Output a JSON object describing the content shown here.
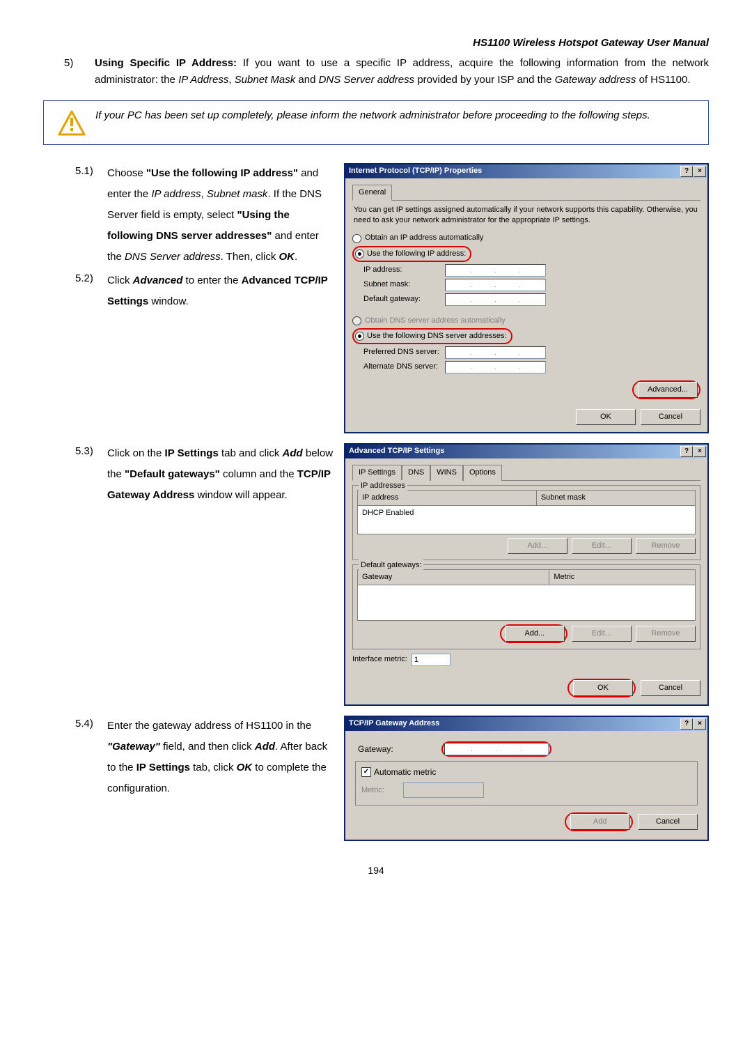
{
  "header": {
    "manual_title": "HS1100 Wireless Hotspot Gateway User Manual"
  },
  "step5": {
    "num": "5)",
    "lead_bold": "Using Specific IP Address:",
    "lead_after": " If you want to use a specific IP address, acquire the following information from the network administrator: the ",
    "i1": "IP Address",
    "c1": ", ",
    "i2": "Subnet Mask",
    "c2": " and ",
    "i3": "DNS Server address",
    "c3": " provided by your ISP and the ",
    "i4": "Gateway address",
    "c4": " of HS1100."
  },
  "warn": "If your PC has been set up completely, please inform the network administrator before proceeding to the following steps.",
  "s51": {
    "num": "5.1)",
    "t1": "Choose ",
    "b1": "\"Use the following IP address\"",
    "t2": " and enter the ",
    "i1": "IP address",
    "t3": ", ",
    "i2": "Subnet mask",
    "t4": ". If the DNS Server field is empty, select ",
    "b2": "\"Using the following DNS server addresses\"",
    "t5": " and enter the ",
    "i3": "DNS Server address",
    "t6": ". Then, click ",
    "bi1": "OK",
    "t7": "."
  },
  "s52": {
    "num": "5.2)",
    "t1": "Click ",
    "bi1": "Advanced",
    "t2": " to enter the ",
    "b1": "Advanced TCP/IP Settings",
    "t3": " window."
  },
  "s53": {
    "num": "5.3)",
    "t1": "Click on the ",
    "b1": "IP Settings",
    "t2": " tab and click ",
    "bi1": "Add",
    "t3": " below the ",
    "b2": "\"Default gateways\"",
    "t4": " column and the ",
    "b3": "TCP/IP Gateway Address",
    "t5": " window will appear."
  },
  "s54": {
    "num": "5.4)",
    "t1": "Enter the gateway address of HS1100 in the ",
    "bi1": "\"Gateway\"",
    "t2": " field, and then click ",
    "bi2": "Add",
    "t3": ". After back to the ",
    "b1": "IP Settings",
    "t4": " tab, click ",
    "bi3": "OK",
    "t5": " to complete the configuration."
  },
  "dlg1": {
    "title": "Internet Protocol (TCP/IP) Properties",
    "help": "?",
    "close": "×",
    "tab_general": "General",
    "desc": "You can get IP settings assigned automatically if your network supports this capability. Otherwise, you need to ask your network administrator for the appropriate IP settings.",
    "r1": "Obtain an IP address automatically",
    "r2": "Use the following IP address:",
    "ip_label": "IP address:",
    "sm_label": "Subnet mask:",
    "gw_label": "Default gateway:",
    "r3": "Obtain DNS server address automatically",
    "r4": "Use the following DNS server addresses:",
    "pdns": "Preferred DNS server:",
    "adns": "Alternate DNS server:",
    "adv": "Advanced...",
    "ok": "OK",
    "cancel": "Cancel"
  },
  "dlg2": {
    "title": "Advanced TCP/IP Settings",
    "help": "?",
    "close": "×",
    "tabs": {
      "a": "IP Settings",
      "b": "DNS",
      "c": "WINS",
      "d": "Options"
    },
    "grp_ip": "IP addresses",
    "col_ip": "IP address",
    "col_sm": "Subnet mask",
    "row1": "DHCP Enabled",
    "add": "Add...",
    "edit": "Edit...",
    "remove": "Remove",
    "grp_gw": "Default gateways:",
    "col_gw": "Gateway",
    "col_mt": "Metric",
    "ifm_label": "Interface metric:",
    "ifm_val": "1",
    "ok": "OK",
    "cancel": "Cancel"
  },
  "dlg3": {
    "title": "TCP/IP Gateway Address",
    "help": "?",
    "close": "×",
    "gw_label": "Gateway:",
    "auto": "Automatic metric",
    "metric": "Metric:",
    "add": "Add",
    "cancel": "Cancel"
  },
  "page_number": "194"
}
